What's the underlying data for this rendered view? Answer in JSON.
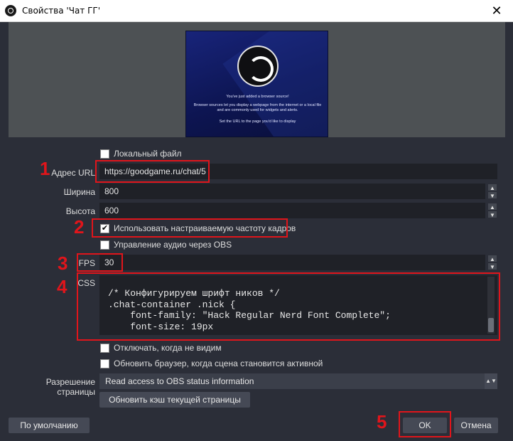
{
  "window": {
    "title": "Свойства 'Чат ГГ'",
    "close_label": "✕"
  },
  "preview": {
    "line1": "You've just added a browser source!",
    "line2": "Browser sources let you display a webpage from the internet or a local file and are commonly used for widgets and alerts.",
    "line3": "Set the URL to the page you'd like to display"
  },
  "form": {
    "local_file_label": "Локальный файл",
    "local_file_checked": false,
    "url_label": "Адрес URL",
    "url_value": "https://goodgame.ru/chat/5",
    "width_label": "Ширина",
    "width_value": "800",
    "height_label": "Высота",
    "height_value": "600",
    "custom_fps_label": "Использовать настраиваемую частоту кадров",
    "custom_fps_checked": true,
    "audio_label": "Управление аудио через OBS",
    "audio_checked": false,
    "fps_label": "FPS",
    "fps_value": "30",
    "css_label": "CSS",
    "css_value": "/* Конфигурируем шрифт ников */\n.chat-container .nick {\n    font-family: \"Hack Regular Nerd Font Complete\";\n    font-size: 19px",
    "shutdown_label": "Отключать, когда не видим",
    "shutdown_checked": false,
    "refresh_label": "Обновить браузер, когда сцена становится активной",
    "refresh_checked": false,
    "permissions_label": "Разрешение страницы",
    "permissions_value": "Read access to OBS status information",
    "refresh_cache_label": "Обновить кэш текущей страницы"
  },
  "footer": {
    "defaults_label": "По умолчанию",
    "ok_label": "OK",
    "cancel_label": "Отмена"
  },
  "annotations": {
    "n1": "1",
    "n2": "2",
    "n3": "3",
    "n4": "4",
    "n5": "5",
    "color": "#e0151b"
  },
  "icons": {
    "spin_up": "▲",
    "spin_down": "▼",
    "check": "✔",
    "dropdown": "▲▼"
  }
}
